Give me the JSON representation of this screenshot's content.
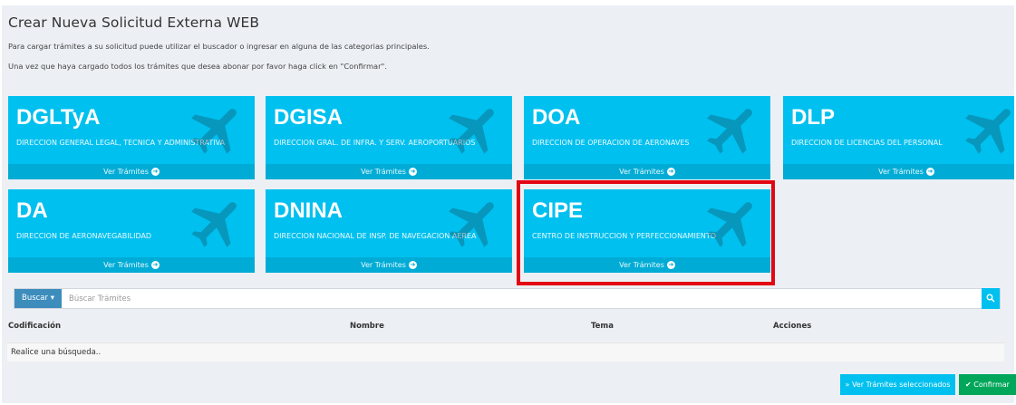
{
  "page": {
    "title": "Crear Nueva Solicitud Externa WEB",
    "intro_line1": "Para cargar trámites a su solicitud puede utilizar el buscador o ingresar en alguna de las categorias principales.",
    "intro_line2": "Una vez que haya cargado todos los trámites que desea abonar por favor haga click en \"Confirmar\"."
  },
  "colors": {
    "tile": "#00c0ef",
    "tile_footer": "#00acd6",
    "highlight": "#e30613",
    "search_button": "#3c8dbc",
    "confirm_button": "#00a65a"
  },
  "tiles": [
    {
      "code": "DGLTyA",
      "desc": "DIRECCION GENERAL LEGAL, TECNICA Y ADMINISTRATIVA",
      "link": "Ver Trámites",
      "icon": "airplane-icon"
    },
    {
      "code": "DGISA",
      "desc": "DIRECCION GRAL. DE INFRA. Y SERV. AEROPORTUARIOS",
      "link": "Ver Trámites",
      "icon": "airplane-icon"
    },
    {
      "code": "DOA",
      "desc": "DIRECCION DE OPERACION DE AERONAVES",
      "link": "Ver Trámites",
      "icon": "airplane-icon"
    },
    {
      "code": "DLP",
      "desc": "DIRECCION DE LICENCIAS DEL PERSONAL",
      "link": "Ver Trámites",
      "icon": "airplane-icon"
    },
    {
      "code": "DA",
      "desc": "DIRECCION DE AERONAVEGABILIDAD",
      "link": "Ver Trámites",
      "icon": "airplane-icon"
    },
    {
      "code": "DNINA",
      "desc": "DIRECCION NACIONAL DE INSP. DE NAVEGACION AEREA",
      "link": "Ver Trámites",
      "icon": "airplane-icon"
    },
    {
      "code": "CIPE",
      "desc": "CENTRO DE INSTRUCCION Y PERFECCIONAMIENTO",
      "link": "Ver Trámites",
      "icon": "airplane-icon"
    }
  ],
  "search": {
    "button_label": "Buscar",
    "button_icon": "caret-down-icon",
    "placeholder": "Búscar Trámites",
    "go_icon": "search-icon"
  },
  "table": {
    "headers": [
      "Codificación",
      "Nombre",
      "Tema",
      "Acciones"
    ],
    "empty_message": "Realice una búsqueda.."
  },
  "actions": {
    "selected_label": "Ver Trámites seleccionados",
    "selected_icon": "double-chevron-right-icon",
    "confirm_label": "Confirmar",
    "confirm_icon": "check-icon"
  }
}
